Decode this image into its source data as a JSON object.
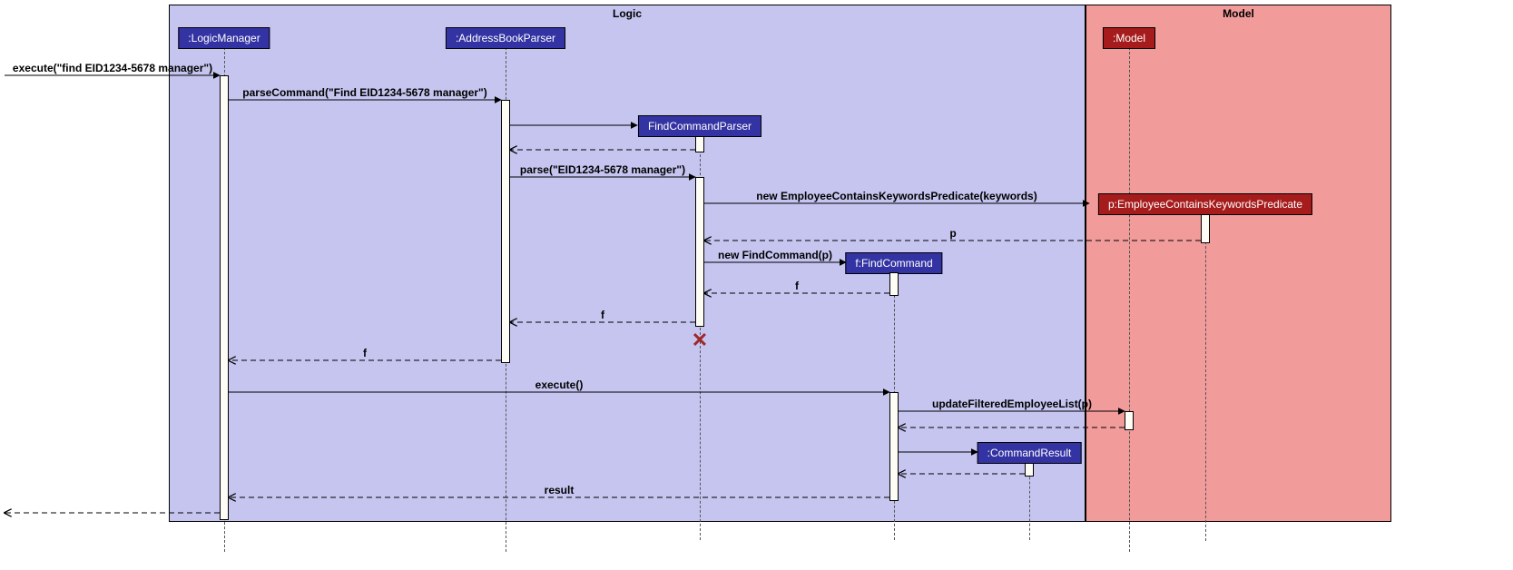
{
  "frames": {
    "logic": {
      "label": "Logic"
    },
    "model": {
      "label": "Model"
    }
  },
  "participants": {
    "logic_manager": ":LogicManager",
    "address_book_parser": ":AddressBookParser",
    "find_command_parser": "FindCommandParser",
    "find_command": "f:FindCommand",
    "command_result": ":CommandResult",
    "model": ":Model",
    "predicate": "p:EmployeeContainsKeywordsPredicate"
  },
  "messages": {
    "m1": "execute(\"find EID1234-5678 manager\")",
    "m2": "parseCommand(\"Find EID1234-5678 manager\")",
    "m3": "parse(\"EID1234-5678 manager\")",
    "m4": "new EmployeeContainsKeywordsPredicate(keywords)",
    "m5": "p",
    "m6": "new FindCommand(p)",
    "m7": "f",
    "m8": "f",
    "m9": "f",
    "m10": "execute()",
    "m11": "updateFilteredEmployeeList(p)",
    "m12": "result"
  }
}
